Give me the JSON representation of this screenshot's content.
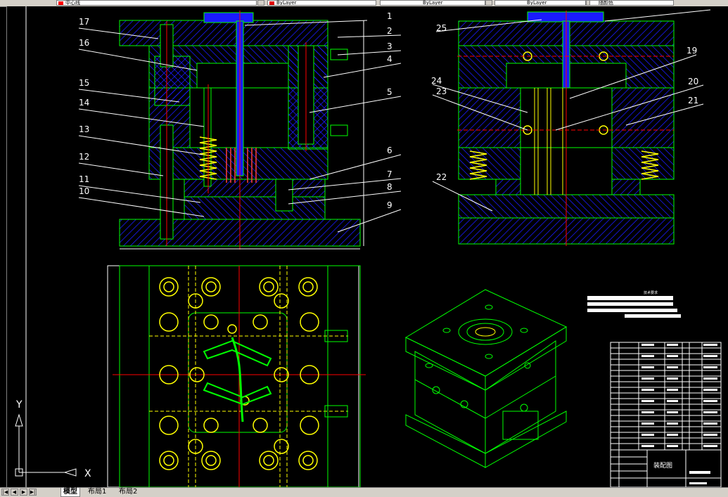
{
  "toolbar": {
    "layer_name": "中心线",
    "color_control": "ByLayer",
    "linetype_control": "ByLayer",
    "lineweight_control": "ByLayer",
    "plotstyle_control": "随颜色"
  },
  "drawing": {
    "part_numbers_left": [
      "17",
      "16",
      "15",
      "14",
      "13",
      "12",
      "11",
      "10"
    ],
    "part_numbers_right": [
      "1",
      "2",
      "3",
      "4",
      "5",
      "6",
      "7",
      "8",
      "9"
    ],
    "part_numbers_section": [
      "25",
      "24",
      "23",
      "22",
      "19",
      "20",
      "21"
    ],
    "tech_requirements_title": "技术要求",
    "title_block_name": "装配图",
    "ucs_x_label": "X",
    "ucs_y_label": "Y"
  },
  "layout_tabs": {
    "model": "模型",
    "layout1": "布局1",
    "layout2": "布局2"
  },
  "colors": {
    "outline": "#00ff00",
    "hatch": "#2020ff",
    "centerline": "#ff0000",
    "spring": "#ffff00",
    "leader": "#ffffff",
    "background": "#000000"
  }
}
